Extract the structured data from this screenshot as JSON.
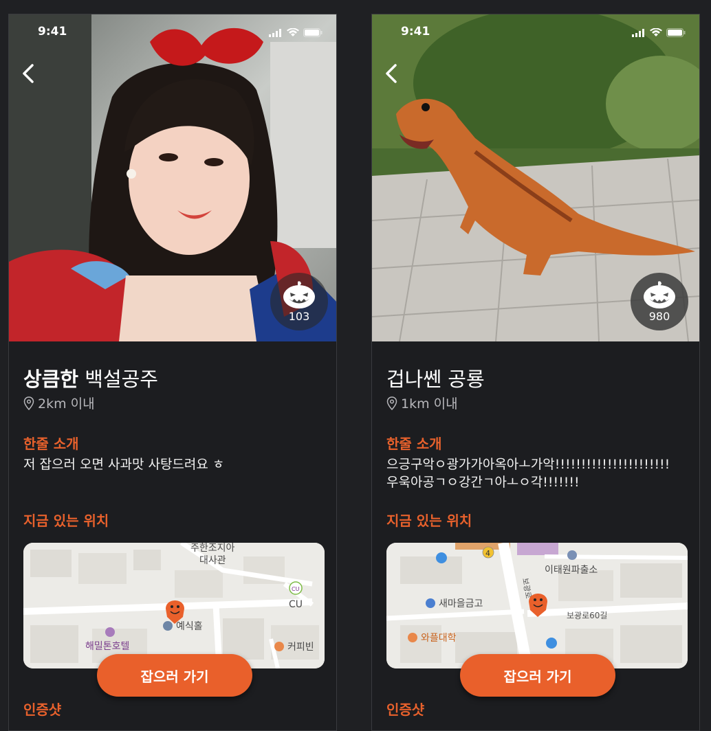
{
  "status_time": "9:41",
  "cards": [
    {
      "name_bold": "상큼한",
      "name_rest": " 백설공주",
      "distance": "2km 이내",
      "intro_title": "한줄 소개",
      "intro_lines": [
        "저 잡으러 오면 사과맛 사탕드려요 ㅎ"
      ],
      "location_title": "지금 있는 위치",
      "map_labels": {
        "poi1": "주한조지아",
        "poi1b": "대사관",
        "poi2": "예식홀",
        "poi3": "해밀톤호텔",
        "poi4": "CU",
        "poi5": "커피빈",
        "cu_logo": "CU"
      },
      "go_button": "잡으러 가기",
      "cert_title": "인증샷",
      "pumpkin_count": "103"
    },
    {
      "name_bold": "",
      "name_rest": "겁나쎈 공룡",
      "distance": "1km 이내",
      "intro_title": "한줄 소개",
      "intro_lines": [
        "으긍구악ㅇ광가가아옥아ㅗ가악!!!!!!!!!!!!!!!!!!!!!!",
        "우욱아공ㄱㅇ강간ㄱ아ㅗㅇ각!!!!!!!"
      ],
      "location_title": "지금 있는 위치",
      "map_labels": {
        "poi1": "이태원파출소",
        "poi2": "새마을금고",
        "poi3": "와플대학",
        "road": "보광로60길",
        "road_v": "보광로",
        "bus_num": "4"
      },
      "go_button": "잡으러 가기",
      "cert_title": "인증샷",
      "pumpkin_count": "980"
    }
  ],
  "colors": {
    "accent": "#e9602b",
    "background": "#1c1d20"
  }
}
